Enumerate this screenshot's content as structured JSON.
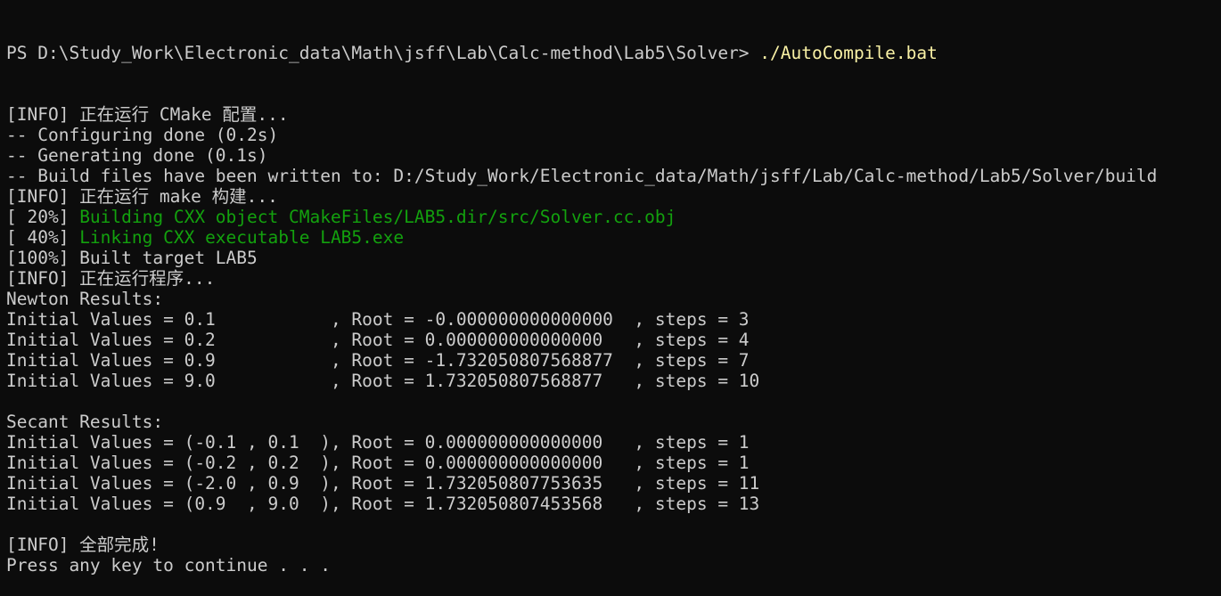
{
  "terminal": {
    "prompt": "PS D:\\Study_Work\\Electronic_data\\Math\\jsff\\Lab\\Calc-method\\Lab5\\Solver> ",
    "command": "./AutoCompile.bat",
    "lines": [
      {
        "text": "[INFO] 正在运行 CMake 配置..."
      },
      {
        "text": "-- Configuring done (0.2s)"
      },
      {
        "text": "-- Generating done (0.1s)"
      },
      {
        "text": "-- Build files have been written to: D:/Study_Work/Electronic_data/Math/jsff/Lab/Calc-method/Lab5/Solver/build"
      },
      {
        "text": "[INFO] 正在运行 make 构建..."
      },
      {
        "prefix": "[ 20%] ",
        "highlight": "Building CXX object CMakeFiles/LAB5.dir/src/Solver.cc.obj"
      },
      {
        "prefix": "[ 40%] ",
        "highlight": "Linking CXX executable LAB5.exe"
      },
      {
        "text": "[100%] Built target LAB5"
      },
      {
        "text": "[INFO] 正在运行程序..."
      },
      {
        "text": "Newton Results:"
      },
      {
        "text": "Initial Values = 0.1           , Root = -0.000000000000000  , steps = 3"
      },
      {
        "text": "Initial Values = 0.2           , Root = 0.000000000000000   , steps = 4"
      },
      {
        "text": "Initial Values = 0.9           , Root = -1.732050807568877  , steps = 7"
      },
      {
        "text": "Initial Values = 9.0           , Root = 1.732050807568877   , steps = 10"
      },
      {
        "text": ""
      },
      {
        "text": "Secant Results:"
      },
      {
        "text": "Initial Values = (-0.1 , 0.1  ), Root = 0.000000000000000   , steps = 1"
      },
      {
        "text": "Initial Values = (-0.2 , 0.2  ), Root = 0.000000000000000   , steps = 1"
      },
      {
        "text": "Initial Values = (-2.0 , 0.9  ), Root = 1.732050807753635   , steps = 11"
      },
      {
        "text": "Initial Values = (0.9  , 9.0  ), Root = 1.732050807453568   , steps = 13"
      },
      {
        "text": ""
      },
      {
        "text": "[INFO] 全部完成!"
      },
      {
        "text": "Press any key to continue . . ."
      }
    ]
  },
  "colors": {
    "background": "#0c0c0c",
    "foreground": "#cccccc",
    "command": "#f9f1a5",
    "progress_highlight": "#13a10e"
  }
}
